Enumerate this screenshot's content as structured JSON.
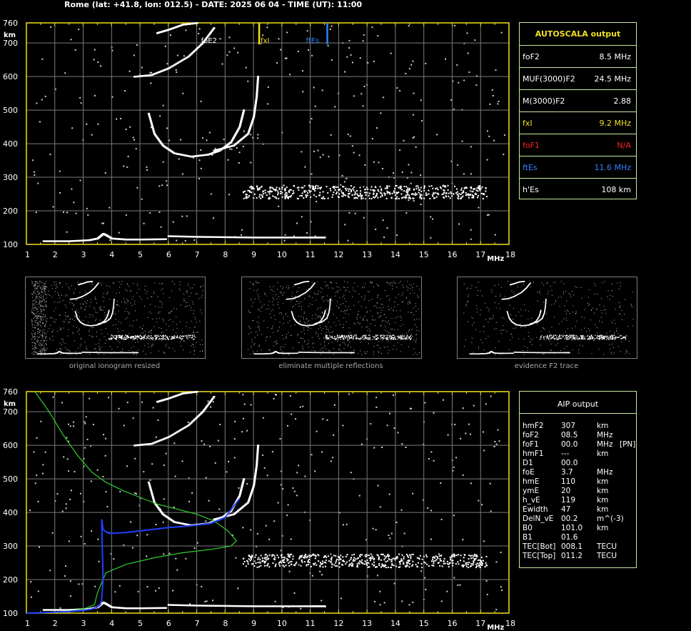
{
  "header": {
    "title": "Rome (lat: +41.8, lon: 012.5) - DATE: 2025 06 04 - TIME (UT): 11:00"
  },
  "axis": {
    "y_unit": "km",
    "x_unit": "MHz",
    "y_ticks": [
      "100",
      "200",
      "300",
      "400",
      "500",
      "600",
      "700",
      "760"
    ],
    "x_ticks": [
      "1",
      "2",
      "3",
      "4",
      "5",
      "6",
      "7",
      "8",
      "9",
      "10",
      "11",
      "12",
      "13",
      "14",
      "15",
      "16",
      "17",
      "18"
    ]
  },
  "markers": [
    {
      "label": "foE2",
      "freq": 7.1,
      "color": "#ffffff"
    },
    {
      "label": "fxI",
      "freq": 9.2,
      "color": "#f0e020"
    },
    {
      "label": "ftEs",
      "freq": 11.6,
      "color": "#3080ff"
    }
  ],
  "autoscala": {
    "title": "AUTOSCALA output",
    "rows": [
      {
        "key": "foF2",
        "value": "8.5 MHz",
        "color": "#ffffff"
      },
      {
        "key": "MUF(3000)F2",
        "value": "24.5 MHz",
        "color": "#ffffff"
      },
      {
        "key": "M(3000)F2",
        "value": "2.88",
        "color": "#ffffff"
      },
      {
        "key": "fxI",
        "value": "9.2 MHz",
        "color": "#f0e020"
      },
      {
        "key": "foF1",
        "value": "N/A",
        "color": "#ff2020"
      },
      {
        "key": "ftEs",
        "value": "11.6 MHz",
        "color": "#3080ff"
      },
      {
        "key": "h'Es",
        "value": "108     km",
        "color": "#ffffff"
      }
    ]
  },
  "aip": {
    "title": "AIP output",
    "rows": [
      {
        "key": "hmF2",
        "value": "307",
        "unit": "km",
        "extra": ""
      },
      {
        "key": "foF2",
        "value": "08.5",
        "unit": "MHz",
        "extra": ""
      },
      {
        "key": "foF1",
        "value": "00.0",
        "unit": "MHz",
        "extra": "[PN]"
      },
      {
        "key": "hmF1",
        "value": "---",
        "unit": "km",
        "extra": ""
      },
      {
        "key": "D1",
        "value": "00.0",
        "unit": "",
        "extra": ""
      },
      {
        "key": "foE",
        "value": "3.7",
        "unit": "MHz",
        "extra": ""
      },
      {
        "key": "hmE",
        "value": "110",
        "unit": "km",
        "extra": ""
      },
      {
        "key": "ymE",
        "value": "20",
        "unit": "km",
        "extra": ""
      },
      {
        "key": "h_vE",
        "value": "119",
        "unit": "km",
        "extra": ""
      },
      {
        "key": "Ewidth",
        "value": "47",
        "unit": "km",
        "extra": ""
      },
      {
        "key": "DelN_vE",
        "value": "00.2",
        "unit": "m^(-3)",
        "extra": ""
      },
      {
        "key": "B0",
        "value": "101.0",
        "unit": "km",
        "extra": ""
      },
      {
        "key": "B1",
        "value": "01.6",
        "unit": "",
        "extra": ""
      },
      {
        "key": "TEC[Bot]",
        "value": "008.1",
        "unit": "TECU",
        "extra": ""
      },
      {
        "key": "TEC[Top]",
        "value": "011.2",
        "unit": "TECU",
        "extra": ""
      }
    ]
  },
  "thumbnails": [
    {
      "caption": "original ionogram resized"
    },
    {
      "caption": "eliminate multiple reflections"
    },
    {
      "caption": "evidence F2 trace"
    }
  ],
  "chart_data": [
    {
      "type": "scatter",
      "name_hint": "ionogram",
      "xlim": [
        1,
        18
      ],
      "ylim": [
        100,
        760
      ],
      "grid": true,
      "traces": [
        {
          "id": "E",
          "color": "#ffffff",
          "points": [
            [
              1.6,
              110
            ],
            [
              2.5,
              110
            ],
            [
              3.2,
              113
            ],
            [
              3.5,
              118
            ],
            [
              3.7,
              132
            ],
            [
              3.8,
              128
            ],
            [
              4.0,
              118
            ],
            [
              4.5,
              115
            ],
            [
              5.0,
              115
            ],
            [
              5.9,
              116
            ]
          ]
        },
        {
          "id": "E2",
          "color": "#ffffff",
          "points": [
            [
              6.0,
              125
            ],
            [
              7.0,
              123
            ],
            [
              8.0,
              122
            ],
            [
              9.0,
              121
            ],
            [
              10.0,
              121
            ],
            [
              11.0,
              121
            ],
            [
              11.5,
              121
            ]
          ]
        },
        {
          "id": "F2o",
          "color": "#ffffff",
          "points": [
            [
              5.3,
              490
            ],
            [
              5.5,
              430
            ],
            [
              5.8,
              395
            ],
            [
              6.2,
              372
            ],
            [
              6.8,
              362
            ],
            [
              7.4,
              368
            ],
            [
              7.8,
              380
            ],
            [
              8.2,
              405
            ],
            [
              8.5,
              450
            ],
            [
              8.65,
              500
            ]
          ]
        },
        {
          "id": "F2x",
          "color": "#ffffff",
          "points": [
            [
              7.6,
              380
            ],
            [
              8.3,
              395
            ],
            [
              8.8,
              430
            ],
            [
              9.0,
              480
            ],
            [
              9.1,
              540
            ],
            [
              9.15,
              600
            ]
          ]
        },
        {
          "id": "F2m",
          "color": "#ffffff",
          "points": [
            [
              4.8,
              600
            ],
            [
              5.4,
              605
            ],
            [
              6.0,
              625
            ],
            [
              6.7,
              660
            ],
            [
              7.2,
              700
            ],
            [
              7.6,
              745
            ]
          ]
        },
        {
          "id": "F2m2",
          "color": "#ffffff",
          "points": [
            [
              5.6,
              730
            ],
            [
              6.0,
              740
            ],
            [
              6.5,
              755
            ],
            [
              7.0,
              760
            ]
          ]
        },
        {
          "id": "Es2",
          "color": "#ffffff",
          "points": [
            [
              8.6,
              245
            ],
            [
              10,
              250
            ],
            [
              11,
              255
            ],
            [
              12,
              258
            ],
            [
              13,
              260
            ],
            [
              14,
              262
            ],
            [
              15,
              262
            ],
            [
              16,
              262
            ],
            [
              17.2,
              262
            ]
          ]
        }
      ]
    },
    {
      "type": "line",
      "name_hint": "profile",
      "xlim": [
        1,
        18
      ],
      "ylim": [
        100,
        760
      ],
      "grid": true,
      "series": [
        {
          "id": "green",
          "color": "#30d030",
          "x": [
            1.3,
            1.8,
            2.3,
            2.8,
            3.3,
            3.8,
            4.4,
            5.0,
            5.6,
            6.3,
            7.0,
            7.6,
            8.1,
            8.4,
            8.2,
            7.5,
            6.5,
            5.5,
            4.5,
            3.8,
            3.5,
            3.4,
            3.0,
            2.5,
            2.0,
            1.5,
            1.0
          ],
          "y": [
            760,
            700,
            630,
            570,
            520,
            490,
            465,
            445,
            425,
            410,
            395,
            375,
            345,
            315,
            300,
            290,
            280,
            265,
            245,
            220,
            160,
            125,
            112,
            106,
            103,
            101,
            100
          ]
        },
        {
          "id": "blue",
          "color": "#2040ff",
          "x": [
            1.0,
            1.5,
            2.0,
            2.5,
            3.0,
            3.3,
            3.5,
            3.6,
            3.65,
            3.7,
            3.65,
            3.7,
            3.8,
            4.0,
            4.5,
            5.0,
            5.5,
            6.0,
            6.5,
            7.0,
            7.5,
            8.0,
            8.5
          ],
          "y": [
            100,
            101,
            103,
            105,
            108,
            112,
            118,
            125,
            140,
            200,
            380,
            350,
            342,
            338,
            340,
            345,
            350,
            355,
            358,
            362,
            368,
            385,
            440
          ]
        },
        {
          "id": "F2o",
          "color": "#ffffff",
          "x": [
            5.3,
            5.5,
            5.8,
            6.2,
            6.8,
            7.4,
            7.8,
            8.2,
            8.5,
            8.65
          ],
          "y": [
            490,
            430,
            395,
            372,
            362,
            368,
            380,
            405,
            450,
            500
          ]
        },
        {
          "id": "F2x",
          "color": "#ffffff",
          "x": [
            7.6,
            8.3,
            8.8,
            9.0,
            9.1,
            9.15
          ],
          "y": [
            380,
            395,
            430,
            480,
            540,
            600
          ]
        },
        {
          "id": "E",
          "color": "#ffffff",
          "x": [
            3.5,
            3.7,
            3.8,
            4.0,
            5.0,
            6.0,
            8.0,
            11.5
          ],
          "y": [
            118,
            132,
            128,
            118,
            115,
            116,
            122,
            121
          ]
        }
      ]
    }
  ]
}
